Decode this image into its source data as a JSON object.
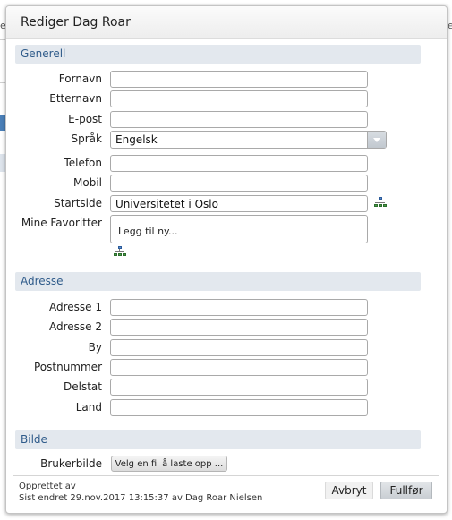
{
  "background": {
    "fragment_a": "e",
    "fragment_b": "e"
  },
  "dialog": {
    "title": "Rediger Dag Roar",
    "sections": {
      "general": "Generell",
      "address": "Adresse",
      "image": "Bilde"
    },
    "general": {
      "fornavn": {
        "label": "Fornavn",
        "value": ""
      },
      "etternavn": {
        "label": "Etternavn",
        "value": ""
      },
      "epost": {
        "label": "E-post",
        "value": ""
      },
      "sprak": {
        "label": "Språk",
        "value": "Engelsk"
      },
      "telefon": {
        "label": "Telefon",
        "value": ""
      },
      "mobil": {
        "label": "Mobil",
        "value": ""
      },
      "startside": {
        "label": "Startside",
        "value": "Universitetet i Oslo"
      },
      "favoritter": {
        "label": "Mine Favoritter",
        "add_label": "Legg til ny..."
      }
    },
    "address": {
      "adresse1": {
        "label": "Adresse 1",
        "value": ""
      },
      "adresse2": {
        "label": "Adresse 2",
        "value": ""
      },
      "by": {
        "label": "By",
        "value": ""
      },
      "postnummer": {
        "label": "Postnummer",
        "value": ""
      },
      "delstat": {
        "label": "Delstat",
        "value": ""
      },
      "land": {
        "label": "Land",
        "value": ""
      }
    },
    "image": {
      "label": "Brukerbilde",
      "button": "Velg en fil å laste opp ..."
    },
    "footer": {
      "created": "Opprettet av",
      "modified": "Sist endret 29.nov.2017 13:15:37 av Dag Roar Nielsen",
      "cancel": "Avbryt",
      "finish": "Fullfør"
    }
  },
  "icons": {
    "startside_picker": "tree-structure-icon",
    "favorites_picker": "tree-structure-icon"
  }
}
